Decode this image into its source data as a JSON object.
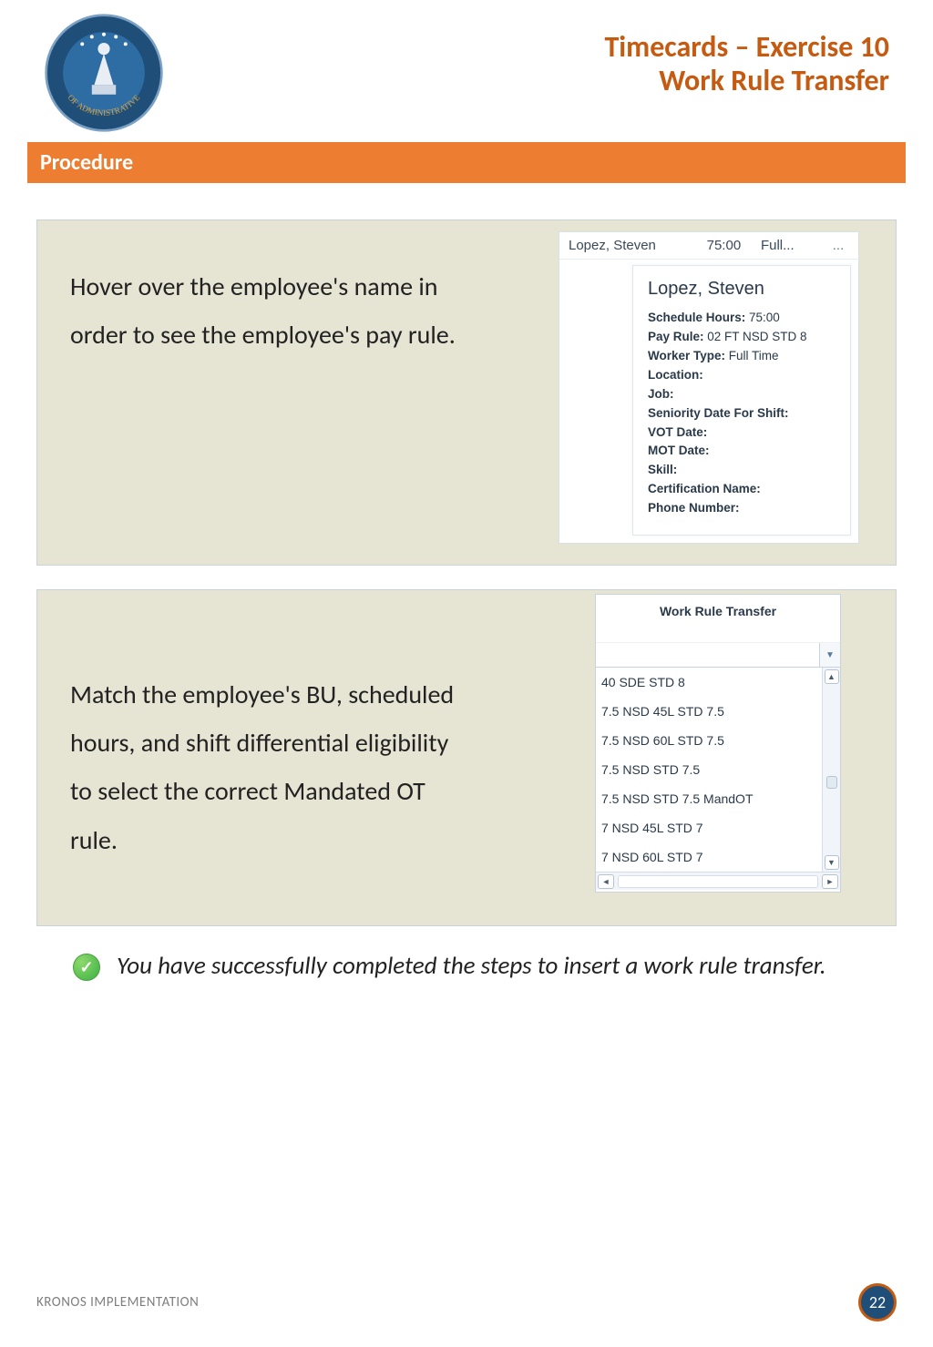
{
  "header": {
    "title_line1": "Timecards – Exercise 10",
    "title_line2": "Work Rule Transfer"
  },
  "procedure_label": "Procedure",
  "panel1": {
    "instruction": "Hover over the employee's name in order to see the employee's pay rule.",
    "row": {
      "name": "Lopez, Steven",
      "hours": "75:00",
      "type": "Full...",
      "more": "..."
    },
    "tooltip": {
      "name": "Lopez, Steven",
      "lines": [
        {
          "label": "Schedule Hours:",
          "value": " 75:00"
        },
        {
          "label": "Pay Rule:",
          "value": " 02 FT NSD STD 8"
        },
        {
          "label": "Worker Type:",
          "value": " Full Time"
        },
        {
          "label": "Location:",
          "value": ""
        },
        {
          "label": "Job:",
          "value": ""
        },
        {
          "label": "Seniority Date For Shift:",
          "value": ""
        },
        {
          "label": "VOT Date:",
          "value": ""
        },
        {
          "label": "MOT Date:",
          "value": ""
        },
        {
          "label": "Skill:",
          "value": ""
        },
        {
          "label": "Certification Name:",
          "value": ""
        },
        {
          "label": "Phone Number:",
          "value": ""
        }
      ]
    }
  },
  "panel2": {
    "instruction": "Match the employee's BU, scheduled hours, and shift differential eligibility to select the correct Mandated OT rule.",
    "widget_title": "Work Rule Transfer",
    "options": [
      "40 SDE STD 8",
      "7.5 NSD 45L STD 7.5",
      "7.5 NSD 60L STD 7.5",
      "7.5 NSD STD 7.5",
      "7.5 NSD STD 7.5 MandOT",
      "7 NSD 45L STD 7",
      "7 NSD 60L STD 7"
    ]
  },
  "completion_text": "You have successfully completed the steps to insert a work rule transfer.",
  "footer": {
    "label": "KRONOS IMPLEMENTATION",
    "page": "22"
  }
}
